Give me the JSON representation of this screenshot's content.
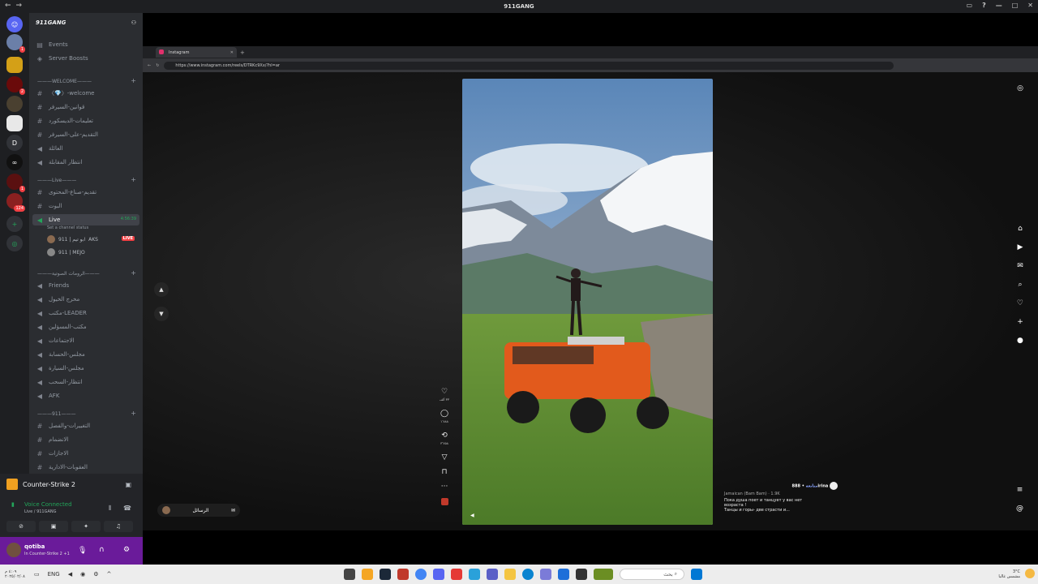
{
  "window": {
    "title": "911GANG"
  },
  "server": {
    "name": "911GANG",
    "top_items": [
      "Events",
      "Server Boosts"
    ],
    "categories": [
      {
        "label": "———WELCOME———"
      },
      {
        "label": "———Live———"
      },
      {
        "label": "———الرومات الصوتية———"
      },
      {
        "label": "———911———"
      }
    ],
    "channels_welcome": [
      "〈💎〉-welcome",
      "قوانين-السيرفر",
      "تعليمات-الديسكورد",
      "التقديم-على-السيرفر",
      "العائلة",
      "انتظار المقابلة"
    ],
    "channels_live": [
      "تقديم-صناع-المحتوى",
      "البوت"
    ],
    "live_channel": {
      "name": "Live",
      "timer": "4:56:39",
      "status": "Set a channel status"
    },
    "live_users": [
      {
        "name": "911 | ابو تيم",
        "tag": "AKS",
        "badge": "LIVE"
      },
      {
        "name": "911 | MEJO"
      }
    ],
    "channels_voice": [
      "Friends",
      "مخرج الخيول",
      "مكتب-LEADER",
      "مكتب-المسؤلين",
      "الاجتماعات",
      "مجلس-الحسابة",
      "مجلس-السيارة",
      "انتظار-السحب",
      "AFK"
    ],
    "channels_911": [
      "التغييرات-والفصل",
      "الانضمام",
      "الاجازات",
      "العقوبات-الادارية"
    ]
  },
  "activity": {
    "game": "Counter-Strike 2",
    "voice_status": "Voice Connected",
    "voice_sub": "Live / 911GANG"
  },
  "user": {
    "name": "qotiba",
    "sub": "In Counter-Strike 2 +1"
  },
  "browser": {
    "tab_title": "Instagram",
    "url": "https://www.instagram.com/reels/DTRKc9Xx/?hl=ar"
  },
  "reel": {
    "likes": "٣٣ ألف",
    "comments": "١٬٨٨٨",
    "shares": "٣٬٧٥٨",
    "author": "888irina",
    "follow": "متابعة",
    "audio": "Jamaican (Bam Bam) · 1.9K",
    "caption_line1": "Пока душа поет и танцует у вас нет",
    "caption_line2": "возраста !",
    "caption_line3": "Танцы и горы- две страсти и...",
    "messages_label": "الرسائل"
  },
  "taskbar": {
    "search_placeholder": "بحث",
    "time": "٤:٠٩ م",
    "date": "٢٠٢٥/٠٢/٠٨",
    "lang": "ENG",
    "weather": "3°C",
    "weather_sub": "مشمس غالبا"
  }
}
